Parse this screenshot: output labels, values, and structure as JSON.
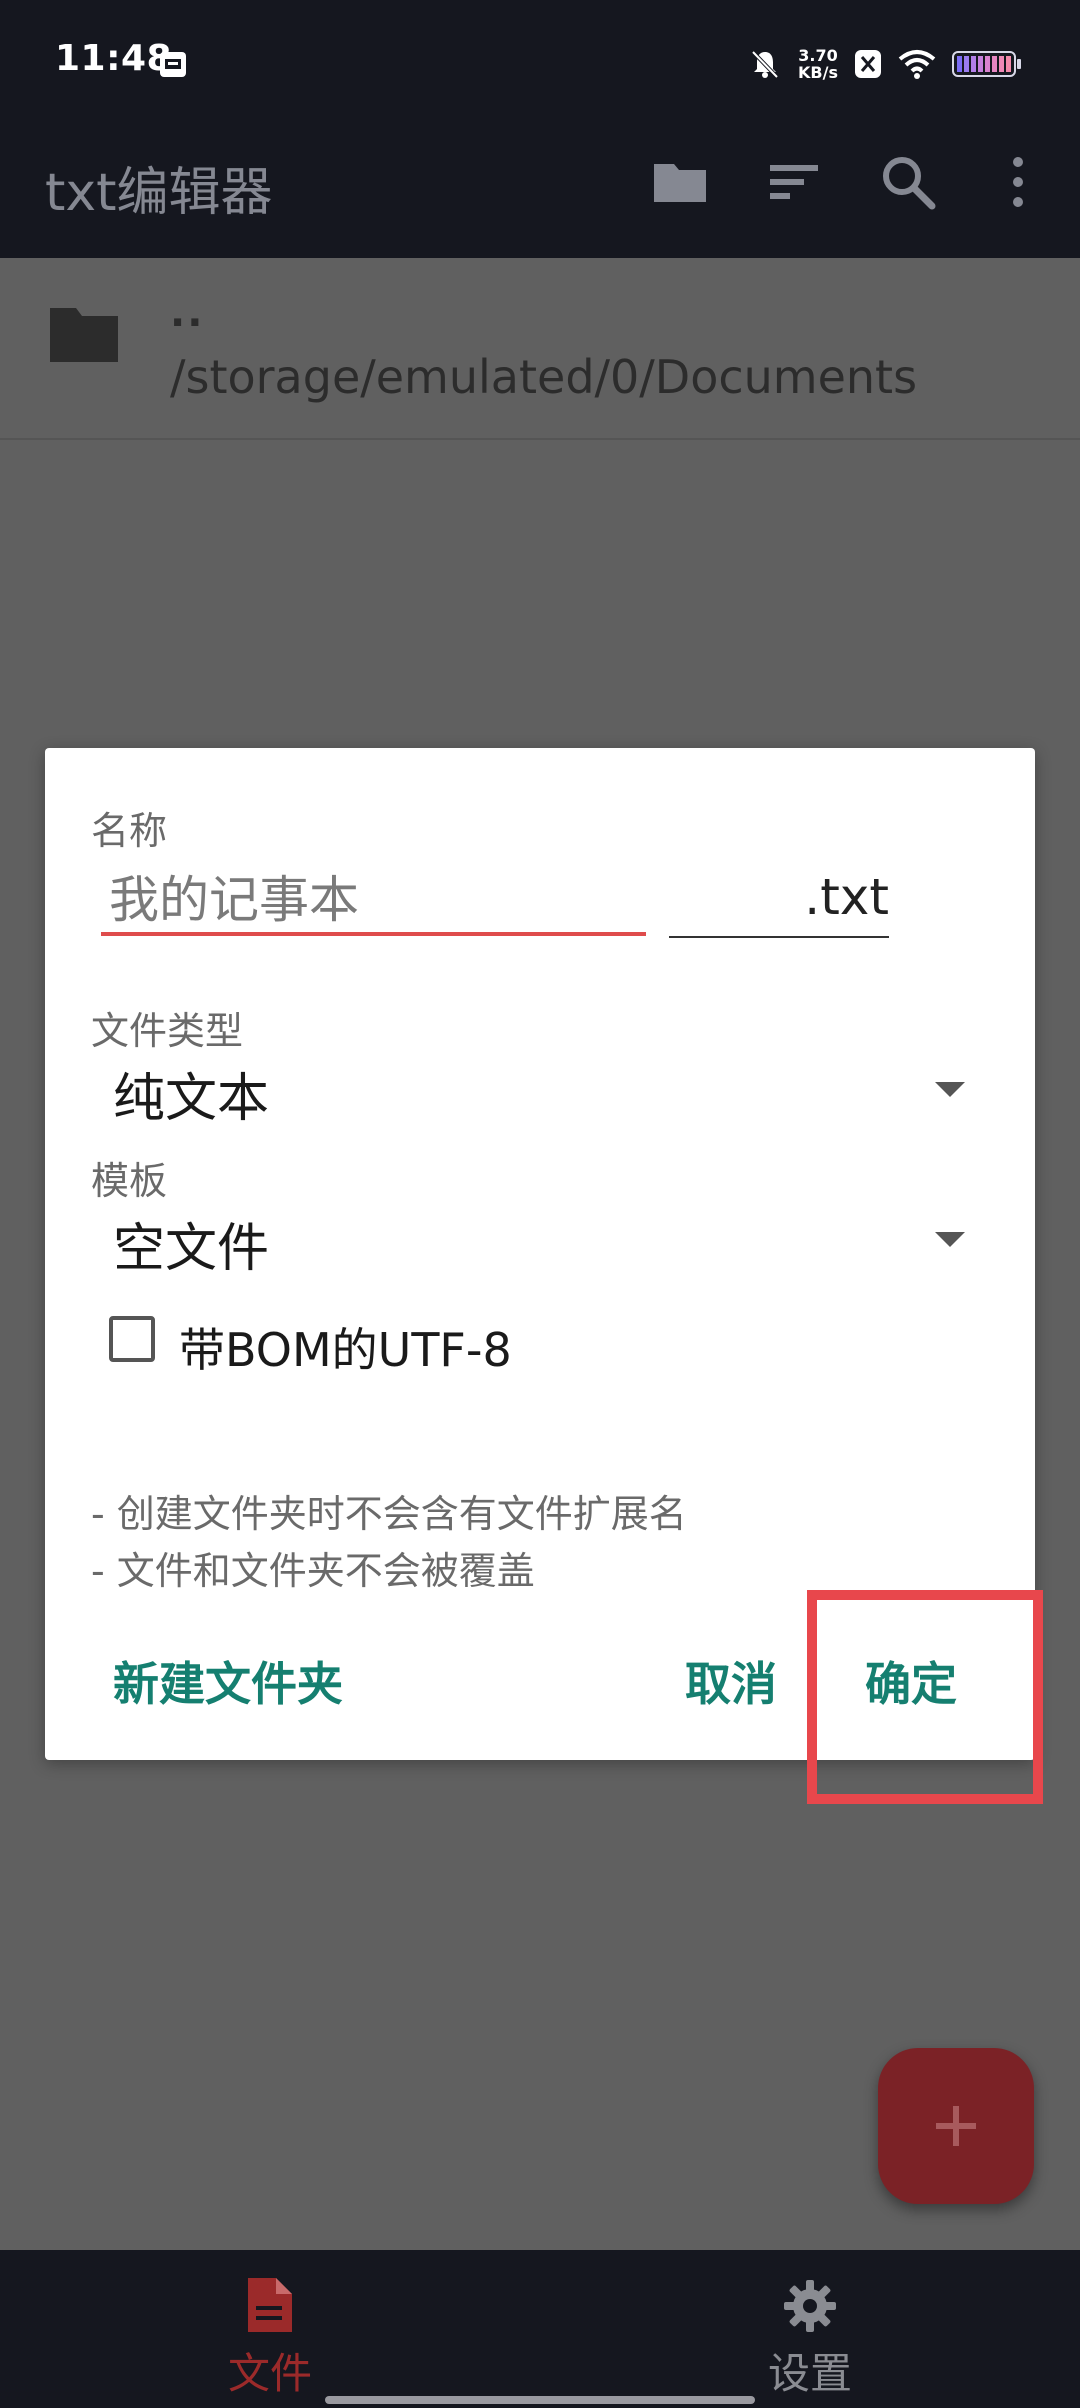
{
  "status_bar": {
    "time": "11:48",
    "net_speed_value": "3.70",
    "net_speed_unit": "KB/s"
  },
  "app_bar": {
    "title": "txt编辑器",
    "icons": [
      "folder-icon",
      "sort-icon",
      "search-icon",
      "more-vert-icon"
    ]
  },
  "file_list": {
    "parent_label": "..",
    "path": "/storage/emulated/0/Documents"
  },
  "dialog": {
    "name_label": "名称",
    "name_placeholder": "我的记事本",
    "extension": ".txt",
    "file_type_label": "文件类型",
    "file_type_value": "纯文本",
    "template_label": "模板",
    "template_value": "空文件",
    "bom_label": "带BOM的UTF-8",
    "bom_checked": false,
    "notes": [
      "- 创建文件夹时不会含有文件扩展名",
      "- 文件和文件夹不会被覆盖"
    ],
    "buttons": {
      "new_folder": "新建文件夹",
      "cancel": "取消",
      "ok": "确定"
    }
  },
  "fab": {
    "icon": "plus-icon"
  },
  "bottom_nav": {
    "items": [
      {
        "label": "文件",
        "icon": "file-icon",
        "active": true
      },
      {
        "label": "设置",
        "icon": "gear-icon",
        "active": false
      }
    ]
  },
  "colors": {
    "accent": "#157f70",
    "error_underline": "#df4c4c",
    "highlight": "#e8474c",
    "active_nav": "#9b2a2a"
  }
}
